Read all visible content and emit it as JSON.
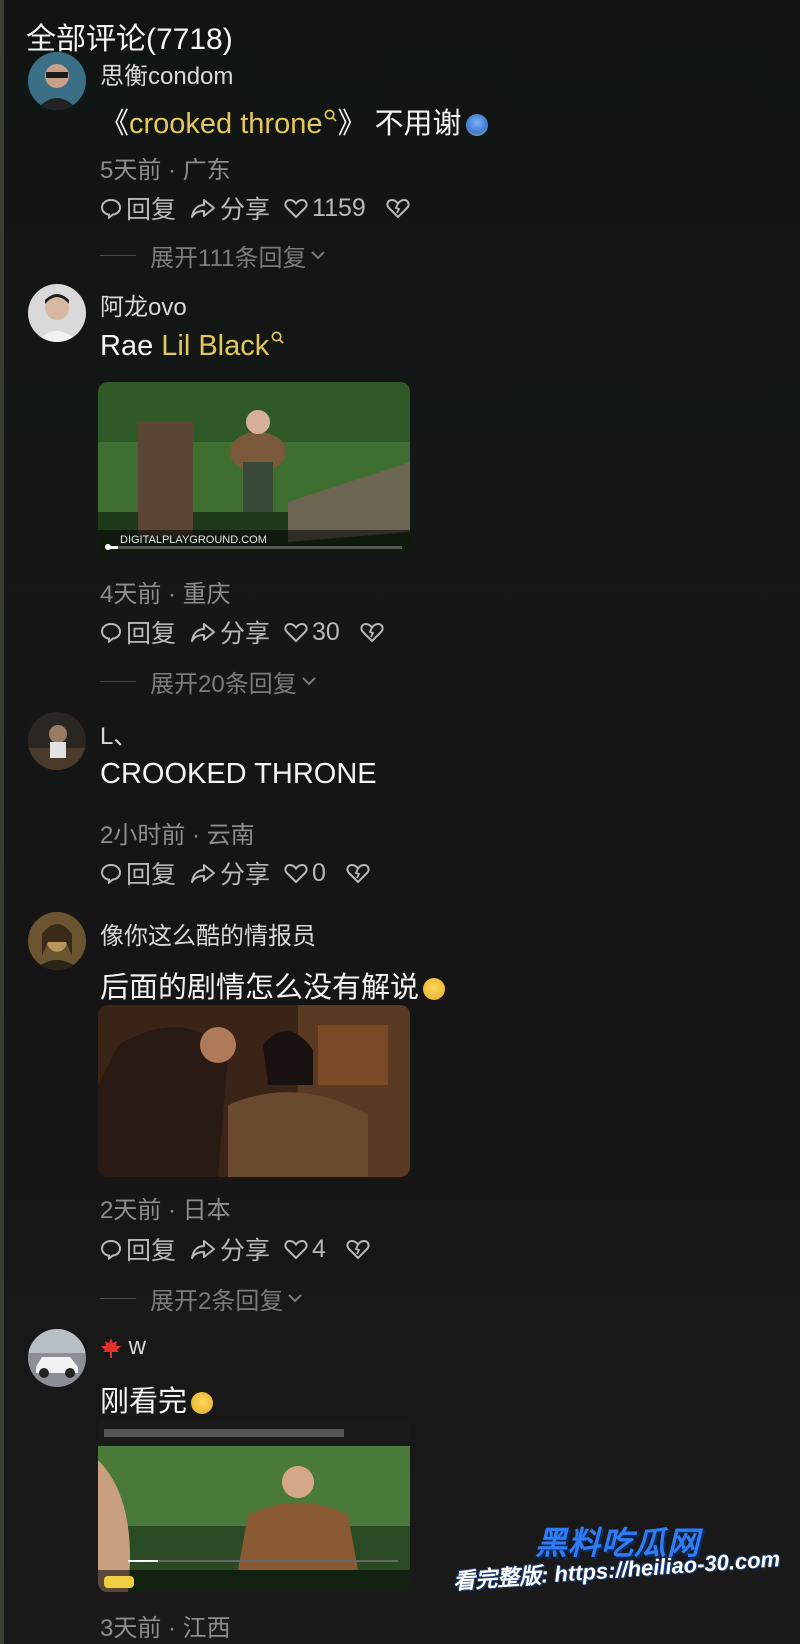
{
  "header": {
    "title": "全部评论(7718)"
  },
  "comments": [
    {
      "username": "思衡condom",
      "text_parts": [
        "《",
        "crooked throne",
        "》 不用谢"
      ],
      "meta": "5天前 · 广东",
      "reply_label": "回复",
      "share_label": "分享",
      "likes": "1159",
      "expand": "展开111条回复"
    },
    {
      "username": "阿龙ovo",
      "text_prefix": "Rae ",
      "text_keyword": "Lil Black",
      "media_caption": "DIGITALPLAYGROUND.COM",
      "meta": "4天前 · 重庆",
      "reply_label": "回复",
      "share_label": "分享",
      "likes": "30",
      "expand": "展开20条回复"
    },
    {
      "username": "L、",
      "text": "CROOKED THRONE",
      "meta": "2小时前 · 云南",
      "reply_label": "回复",
      "share_label": "分享",
      "likes": "0"
    },
    {
      "username": "像你这么酷的情报员",
      "text": "后面的剧情怎么没有解说",
      "meta": "2天前 · 日本",
      "reply_label": "回复",
      "share_label": "分享",
      "likes": "4",
      "expand": "展开2条回复"
    },
    {
      "username": "w",
      "text": "刚看完",
      "meta": "3天前 · 江西"
    }
  ],
  "watermark": {
    "brand": "黑料吃瓜网",
    "url_line": "看完整版: https://heiliao-30.com"
  },
  "colors": {
    "keyword": "#e6c75a",
    "meta": "#8d8d8d",
    "watermark": "#2f7df5"
  }
}
